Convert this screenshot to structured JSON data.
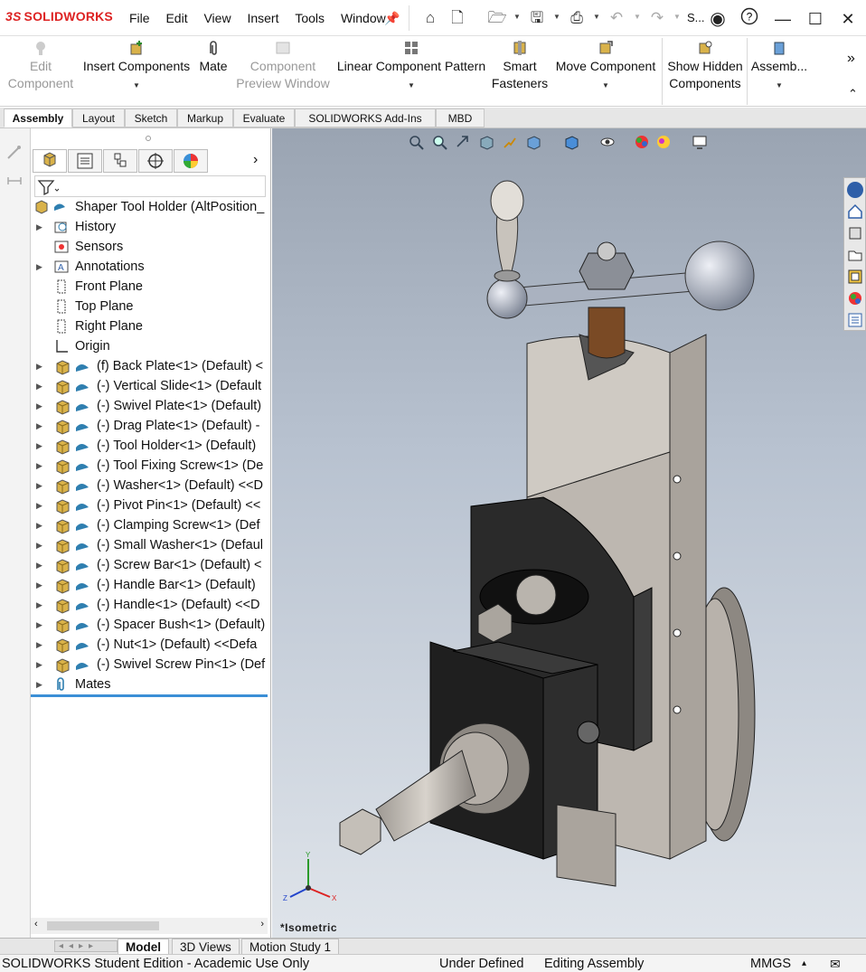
{
  "app": {
    "logo_text": "SOLIDWORKS",
    "logo_prefix": "3S",
    "brand_color": "#d22020",
    "accent_color": "#3b8fd6"
  },
  "menu": [
    "File",
    "Edit",
    "View",
    "Insert",
    "Tools",
    "Window"
  ],
  "title_truncated": "S...",
  "window_controls": {
    "minimize_icon": "minimize-icon",
    "maximize_icon": "maximize-icon",
    "close_icon": "close-icon",
    "help_icon": "help-icon",
    "user_icon": "user-icon"
  },
  "ribbon": {
    "edit_component": [
      "Edit",
      "Component"
    ],
    "insert_components": "Insert Components",
    "mate": "Mate",
    "component_preview": [
      "Component",
      "Preview Window"
    ],
    "linear_pattern": "Linear Component Pattern",
    "smart_fasteners": [
      "Smart",
      "Fasteners"
    ],
    "move_component": "Move Component",
    "show_hidden": [
      "Show Hidden",
      "Components"
    ],
    "assembly": "Assemb..."
  },
  "tabs": [
    "Assembly",
    "Layout",
    "Sketch",
    "Markup",
    "Evaluate",
    "SOLIDWORKS Add-Ins",
    "MBD"
  ],
  "active_tab": "Assembly",
  "tree": {
    "root": "Shaper Tool Holder  (AltPosition_",
    "items": [
      {
        "label": "History",
        "icon": "history-icon",
        "expand": true
      },
      {
        "label": "Sensors",
        "icon": "sensors-icon",
        "expand": false
      },
      {
        "label": "Annotations",
        "icon": "annotations-icon",
        "expand": true
      },
      {
        "label": "Front Plane",
        "icon": "plane-icon",
        "expand": false
      },
      {
        "label": "Top Plane",
        "icon": "plane-icon",
        "expand": false
      },
      {
        "label": "Right Plane",
        "icon": "plane-icon",
        "expand": false
      },
      {
        "label": "Origin",
        "icon": "origin-icon",
        "expand": false
      }
    ],
    "components": [
      "(f) Back Plate<1> (Default) <",
      "(-) Vertical Slide<1> (Default",
      "(-) Swivel Plate<1> (Default)",
      "(-) Drag Plate<1> (Default) -",
      "(-) Tool Holder<1> (Default)",
      "(-) Tool Fixing Screw<1> (De",
      "(-) Washer<1> (Default) <<D",
      "(-) Pivot Pin<1> (Default) <<",
      "(-) Clamping Screw<1> (Def",
      "(-) Small Washer<1> (Defaul",
      "(-) Screw Bar<1> (Default) <",
      "(-) Handle Bar<1> (Default)",
      "(-) Handle<1> (Default) <<D",
      "(-) Spacer Bush<1> (Default)",
      "(-) Nut<1> (Default) <<Defa",
      "(-) Swivel Screw Pin<1> (Def"
    ],
    "mates": "Mates"
  },
  "viewport": {
    "view_name": "*Isometric",
    "triad": {
      "x": "X",
      "y": "Y",
      "z": "Z"
    }
  },
  "bottom_tabs": [
    "Model",
    "3D Views",
    "Motion Study 1"
  ],
  "status": {
    "edition": "SOLIDWORKS Student Edition - Academic Use Only",
    "state": "Under Defined",
    "mode": "Editing Assembly",
    "units": "MMGS",
    "units_caret": "▴"
  }
}
